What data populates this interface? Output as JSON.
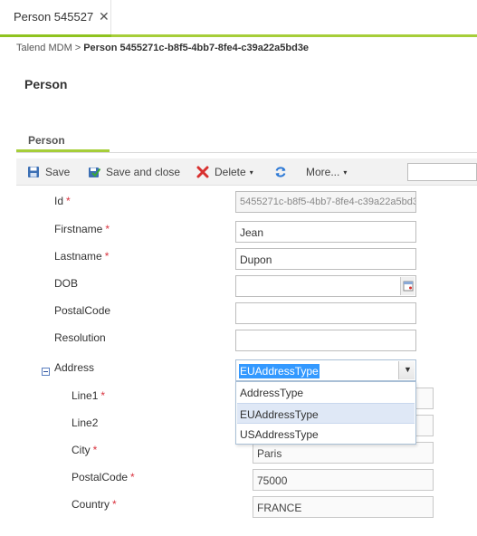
{
  "tab": {
    "title": "Person 545527",
    "close_glyph": "✕"
  },
  "breadcrumb": {
    "root": "Talend MDM",
    "separator": ">",
    "current": "Person 5455271c-b8f5-4bb7-8fe4-c39a22a5bd3e"
  },
  "page_title": "Person",
  "section_tab": "Person",
  "toolbar": {
    "save": "Save",
    "save_and_close": "Save and close",
    "delete": "Delete",
    "more": "More...",
    "caret": "▾",
    "icons": {
      "save": "floppy-disk-icon",
      "save_and_close": "check-disk-icon",
      "delete": "red-x-icon",
      "refresh": "refresh-icon"
    }
  },
  "form": {
    "required_mark": "*",
    "fields": {
      "id": {
        "label": "Id",
        "value": "5455271c-b8f5-4bb7-8fe4-c39a22a5bd3"
      },
      "firstname": {
        "label": "Firstname",
        "value": "Jean"
      },
      "lastname": {
        "label": "Lastname",
        "value": "Dupon"
      },
      "dob": {
        "label": "DOB",
        "value": ""
      },
      "postalcode": {
        "label": "PostalCode",
        "value": ""
      },
      "resolution": {
        "label": "Resolution",
        "value": ""
      }
    },
    "address": {
      "label": "Address",
      "type_selected": "EUAddressType",
      "options": [
        "AddressType",
        "EUAddressType",
        "USAddressType"
      ],
      "selected_option": "EUAddressType",
      "line1": {
        "label": "Line1",
        "value": ""
      },
      "line2": {
        "label": "Line2",
        "value": ""
      },
      "city": {
        "label": "City",
        "value": "Paris"
      },
      "postalcode": {
        "label": "PostalCode",
        "value": "75000"
      },
      "country": {
        "label": "Country",
        "value": "FRANCE"
      }
    }
  },
  "colors": {
    "accent_green": "#a6ce39",
    "required_red": "#d9333f",
    "selection_blue": "#3399ff"
  }
}
